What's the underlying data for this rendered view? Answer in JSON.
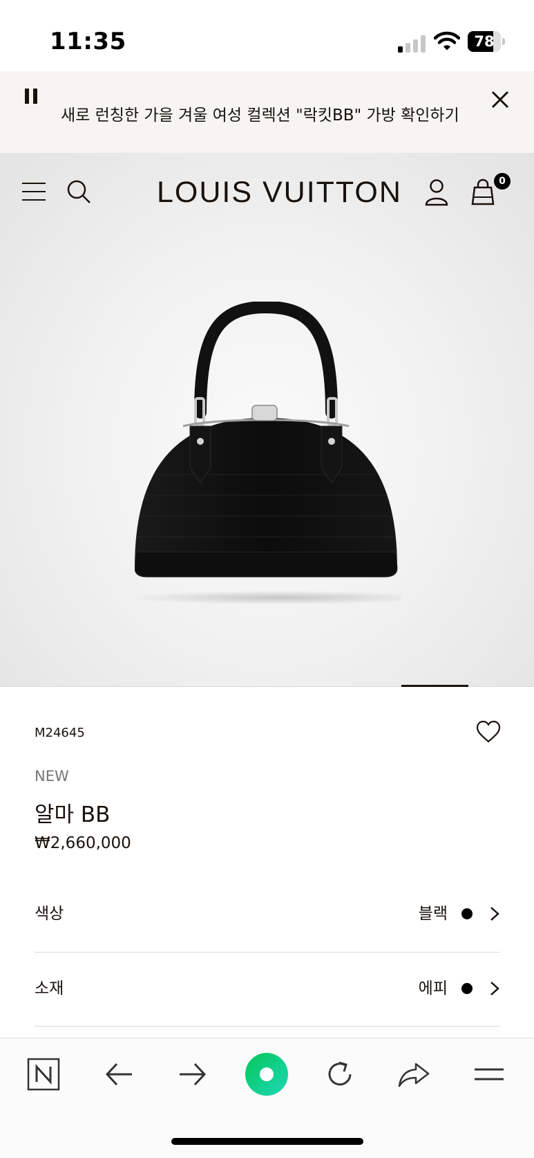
{
  "status_bar": {
    "time": "11:35",
    "battery_level": "78",
    "battery_fraction": 0.78,
    "signal_bars_active": 1,
    "signal_bars_total": 4
  },
  "promo": {
    "text": "새로 런칭한 가을 겨울 여성 컬렉션 \"락킷BB\" 가방 확인하기",
    "pause_icon": "pause-icon",
    "close_icon": "close-icon"
  },
  "header": {
    "logo": "LOUIS VUITTON",
    "cart_count": "0",
    "icons": [
      "menu-icon",
      "search-icon",
      "account-icon",
      "shopping-bag-icon"
    ]
  },
  "carousel": {
    "active_index_fraction": 0.8
  },
  "product": {
    "sku": "M24645",
    "badge": "NEW",
    "name": "알마 BB",
    "price": "₩2,660,000",
    "wishlist_icon": "heart-icon"
  },
  "options": [
    {
      "label": "색상",
      "value": "블랙",
      "swatch_color": "#000000"
    },
    {
      "label": "소재",
      "value": "에피",
      "swatch_color": "#000000"
    }
  ],
  "browser_bar": {
    "icons": [
      "naver-home-icon",
      "back-arrow-icon",
      "forward-arrow-icon",
      "green-dot-icon",
      "refresh-icon",
      "share-icon",
      "menu-lines-icon"
    ]
  },
  "colors": {
    "brand_text": "#19110b",
    "accent_green": "#03c75a"
  }
}
